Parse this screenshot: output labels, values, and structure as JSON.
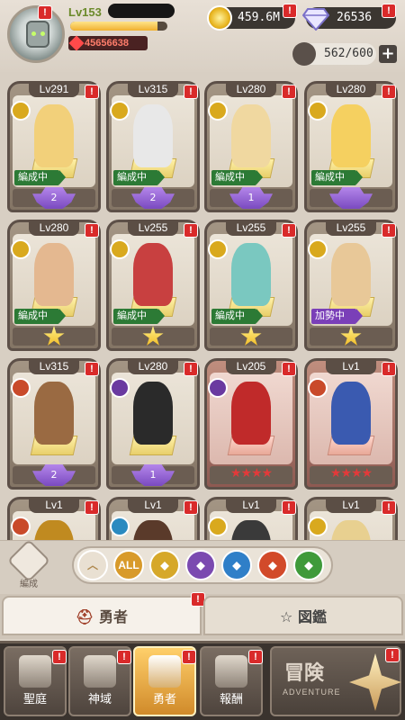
{
  "player": {
    "level": "Lv153",
    "power": "45656638",
    "xp_fraction": 0.9
  },
  "currencies": {
    "gold": "459.6M",
    "gems": "26536",
    "slots": "562/600"
  },
  "badge_mark": "!",
  "heroes": [
    {
      "level": "Lv291",
      "tag": "編成中",
      "tag_color": "green",
      "rank": "purple",
      "rank_text": "2",
      "element": "light"
    },
    {
      "level": "Lv315",
      "tag": "編成中",
      "tag_color": "green",
      "rank": "purple",
      "rank_text": "2",
      "element": "light"
    },
    {
      "level": "Lv280",
      "tag": "編成中",
      "tag_color": "green",
      "rank": "purple",
      "rank_text": "1",
      "element": "light"
    },
    {
      "level": "Lv280",
      "tag": "編成中",
      "tag_color": "green",
      "rank": "purple",
      "rank_text": "",
      "element": "light"
    },
    {
      "level": "Lv280",
      "tag": "編成中",
      "tag_color": "green",
      "rank": "star",
      "rank_text": "",
      "element": "light"
    },
    {
      "level": "Lv255",
      "tag": "編成中",
      "tag_color": "green",
      "rank": "star",
      "rank_text": "",
      "element": "light"
    },
    {
      "level": "Lv255",
      "tag": "編成中",
      "tag_color": "green",
      "rank": "star",
      "rank_text": "",
      "element": "light"
    },
    {
      "level": "Lv255",
      "tag": "加勢中",
      "tag_color": "purple",
      "rank": "star",
      "rank_text": "",
      "element": "light"
    },
    {
      "level": "Lv315",
      "tag": "",
      "tag_color": "",
      "rank": "purple",
      "rank_text": "2",
      "element": "fire"
    },
    {
      "level": "Lv280",
      "tag": "",
      "tag_color": "",
      "rank": "purple",
      "rank_text": "1",
      "element": "dark"
    },
    {
      "level": "Lv205",
      "tag": "",
      "tag_color": "",
      "rank": "stars",
      "rank_text": "★★★★",
      "element": "dark"
    },
    {
      "level": "Lv1",
      "tag": "",
      "tag_color": "",
      "rank": "stars",
      "rank_text": "★★★★",
      "element": "fire"
    },
    {
      "level": "Lv1",
      "tag": "",
      "tag_color": "",
      "rank": "",
      "rank_text": "",
      "element": "fire"
    },
    {
      "level": "Lv1",
      "tag": "",
      "tag_color": "",
      "rank": "",
      "rank_text": "",
      "element": "water"
    },
    {
      "level": "Lv1",
      "tag": "",
      "tag_color": "",
      "rank": "",
      "rank_text": "",
      "element": "light"
    },
    {
      "level": "Lv1",
      "tag": "",
      "tag_color": "",
      "rank": "",
      "rank_text": "",
      "element": "light"
    }
  ],
  "formation_button": "編成",
  "filters": [
    {
      "label": "",
      "icon": "chevron-up-icon",
      "color": "#e9e0d2"
    },
    {
      "label": "ALL",
      "icon": "all-icon",
      "color": "#d89a2a"
    },
    {
      "label": "",
      "icon": "light-element-icon",
      "color": "#d6a82a"
    },
    {
      "label": "",
      "icon": "dark-element-icon",
      "color": "#7b4ab0"
    },
    {
      "label": "",
      "icon": "water-element-icon",
      "color": "#2f7fc8"
    },
    {
      "label": "",
      "icon": "fire-element-icon",
      "color": "#d24a2a"
    },
    {
      "label": "",
      "icon": "nature-element-icon",
      "color": "#3f9a3a"
    }
  ],
  "tabs": {
    "heroes": "勇者",
    "codex": "図鑑"
  },
  "nav": [
    {
      "label": "聖庭",
      "icon": "sanctuary-icon"
    },
    {
      "label": "神域",
      "icon": "divine-realm-icon"
    },
    {
      "label": "勇者",
      "icon": "hero-helmet-icon",
      "active": true
    },
    {
      "label": "報酬",
      "icon": "treasure-chest-icon"
    }
  ],
  "adventure": {
    "label": "冒険",
    "sub": "ADVENTURE"
  }
}
